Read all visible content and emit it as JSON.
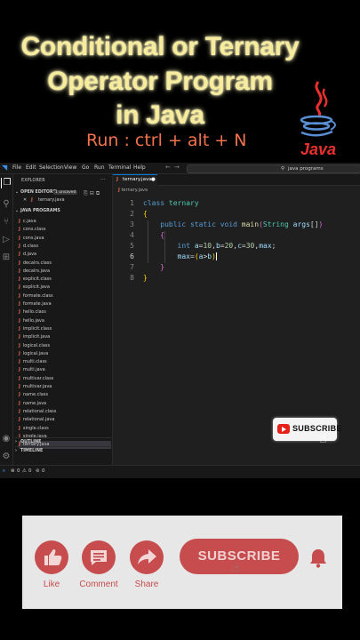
{
  "header": {
    "title_lines": [
      "Conditional or Ternary",
      "Operator Program",
      "in Java"
    ],
    "shortcut": "Run : ctrl + alt + N",
    "logo_text": "Java"
  },
  "vscode": {
    "menu": [
      "File",
      "Edit",
      "Selection",
      "View",
      "Go",
      "Run",
      "Terminal",
      "Help"
    ],
    "search_placeholder": "java programs",
    "sidebar": {
      "title": "EXPLORER",
      "open_editors_label": "OPEN EDITORS",
      "unsaved_badge": "1 unsaved",
      "open_file": "ternary.java",
      "folder_label": "JAVA PROGRAMS",
      "files": [
        "c.java",
        "cons.class",
        "cons.java",
        "d.class",
        "d.java",
        "decalrs.class",
        "decalrs.java",
        "explicit.class",
        "explicit.java",
        "formate.class",
        "formate.java",
        "hello.class",
        "hello.java",
        "implicit.class",
        "implicit.java",
        "logical.class",
        "logical.java",
        "multi.class",
        "multi.java",
        "multivar.class",
        "multivar.java",
        "name.class",
        "name.java",
        "relational.class",
        "relational.java",
        "single.class",
        "single.java",
        "ternary.java"
      ],
      "outline_label": "OUTLINE",
      "timeline_label": "TIMELINE"
    },
    "editor": {
      "tab_label": "ternary.java",
      "breadcrumb": "ternary.java",
      "line_numbers": [
        "1",
        "2",
        "3",
        "4",
        "5",
        "6",
        "7",
        "8"
      ]
    },
    "status": {
      "errors": "0",
      "warnings": "0",
      "ports": "0"
    }
  },
  "overlay": {
    "subscribe_small": "SUBSCRIBE",
    "actions": [
      {
        "label": "Like",
        "icon": "thumbs-up-icon"
      },
      {
        "label": "Comment",
        "icon": "comment-icon"
      },
      {
        "label": "Share",
        "icon": "share-icon"
      }
    ],
    "subscribe_big": "SUBSCRIBE"
  }
}
